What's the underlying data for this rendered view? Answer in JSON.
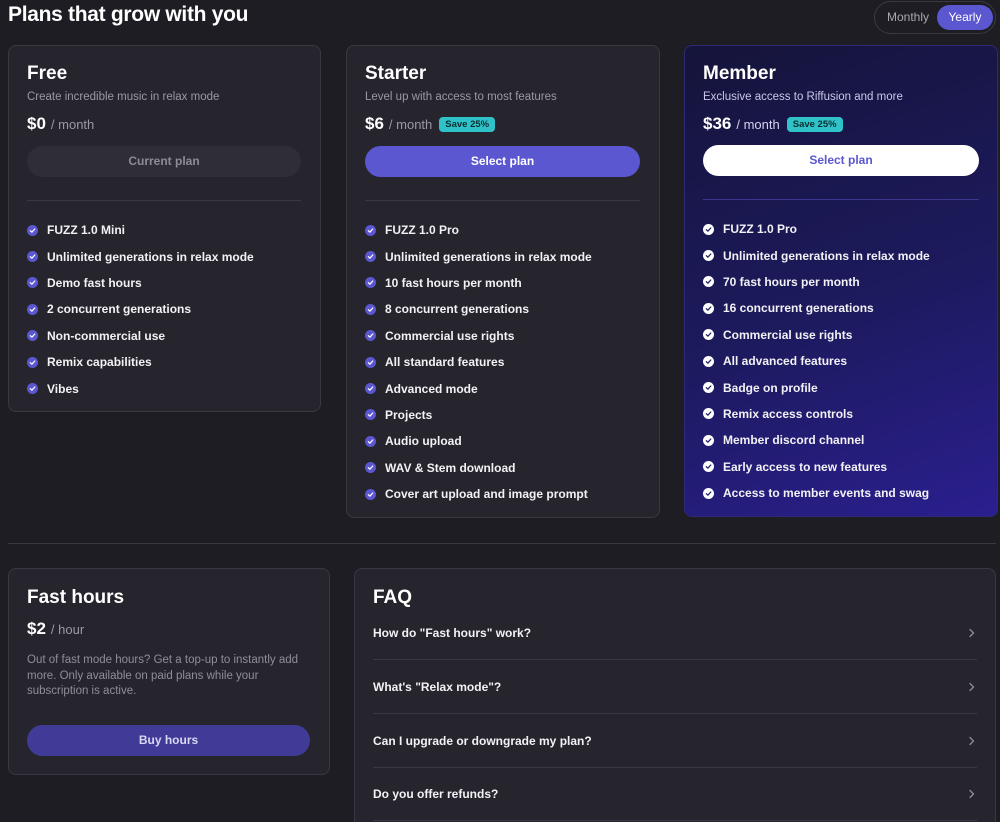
{
  "header": {
    "title": "Plans that grow with you"
  },
  "billing": {
    "monthly": "Monthly",
    "yearly": "Yearly",
    "selected": "Yearly"
  },
  "plans": [
    {
      "name": "Free",
      "desc": "Create incredible music in relax mode",
      "price": "$0",
      "per": "/ month",
      "button": "Current plan",
      "features": [
        "FUZZ 1.0 Mini",
        "Unlimited generations in relax mode",
        "Demo fast hours",
        "2 concurrent generations",
        "Non-commercial use",
        "Remix capabilities",
        "Vibes"
      ]
    },
    {
      "name": "Starter",
      "desc": "Level up with access to most features",
      "price": "$6",
      "per": "/ month",
      "badge": "Save 25%",
      "button": "Select plan",
      "features": [
        "FUZZ 1.0 Pro",
        "Unlimited generations in relax mode",
        "10 fast hours per month",
        "8 concurrent generations",
        "Commercial use rights",
        "All standard features",
        "Advanced mode",
        "Projects",
        "Audio upload",
        "WAV & Stem download",
        "Cover art upload and image prompt"
      ]
    },
    {
      "name": "Member",
      "desc": "Exclusive access to Riffusion and more",
      "price": "$36",
      "per": "/ month",
      "badge": "Save 25%",
      "button": "Select plan",
      "features": [
        "FUZZ 1.0 Pro",
        "Unlimited generations in relax mode",
        "70 fast hours per month",
        "16 concurrent generations",
        "Commercial use rights",
        "All advanced features",
        "Badge on profile",
        "Remix access controls",
        "Member discord channel",
        "Early access to new features",
        "Access to member events and swag"
      ]
    }
  ],
  "fast_hours": {
    "title": "Fast hours",
    "price": "$2",
    "per": "/ hour",
    "desc": "Out of fast mode hours? Get a top-up to instantly add more. Only available on paid plans while your subscription is active.",
    "button": "Buy hours"
  },
  "faq": {
    "title": "FAQ",
    "items": [
      "How do \"Fast hours\" work?",
      "What's \"Relax mode\"?",
      "Can I upgrade or downgrade my plan?",
      "Do you offer refunds?"
    ]
  },
  "colors": {
    "accent": "#5b57d1",
    "badge": "#2fc3c9",
    "background": "#1e1d24",
    "card": "#26252d"
  },
  "icons": {
    "feature": "check-circle-icon",
    "faq": "chevron-right-icon"
  }
}
